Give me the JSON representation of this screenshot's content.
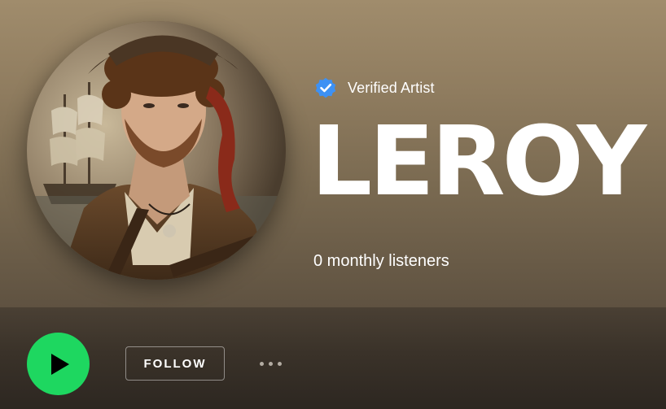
{
  "artist": {
    "verified_label": "Verified Artist",
    "name": "LEROY",
    "monthly_listeners": "0 monthly listeners",
    "avatar_icon": "artist-portrait-image"
  },
  "actions": {
    "play_icon": "play-icon",
    "follow_label": "FOLLOW",
    "more_icon": "more-options-icon"
  },
  "colors": {
    "play_green": "#1ed760",
    "verified_blue": "#3d91f4",
    "hero_gradient_top": "#a08c6c",
    "hero_gradient_bottom": "#5f5241"
  }
}
